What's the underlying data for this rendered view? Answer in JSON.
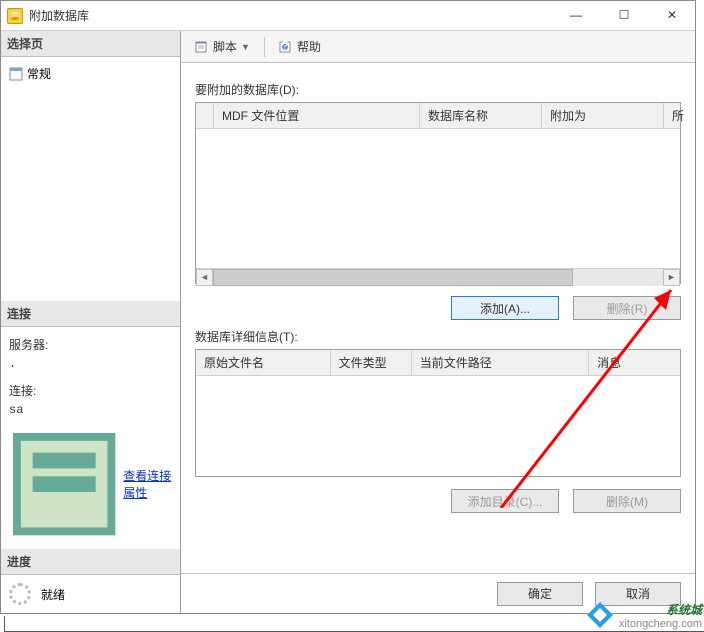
{
  "window": {
    "title": "附加数据库"
  },
  "left": {
    "select_page": "选择页",
    "general": "常规",
    "connection": "连接",
    "server_label": "服务器:",
    "server_value": ".",
    "conn_label": "连接:",
    "conn_value": "sa",
    "view_props": "查看连接属性",
    "progress": "进度",
    "ready": "就绪"
  },
  "toolbar": {
    "script": "脚本",
    "help": "帮助"
  },
  "section1": {
    "label": "要附加的数据库(D):",
    "cols": {
      "c2": "MDF 文件位置",
      "c3": "数据库名称",
      "c4": "附加为",
      "c5": "所"
    },
    "add": "添加(A)...",
    "remove": "删除(R)"
  },
  "section2": {
    "label": "数据库详细信息(T):",
    "cols": {
      "c1": "原始文件名",
      "c2": "文件类型",
      "c3": "当前文件路径",
      "c4": "消息"
    },
    "add_dir": "添加目录(C)...",
    "remove": "删除(M)"
  },
  "footer": {
    "ok": "确定",
    "cancel": "取消"
  },
  "watermark": {
    "brand": "系统城",
    "url": "xitongcheng.com"
  }
}
